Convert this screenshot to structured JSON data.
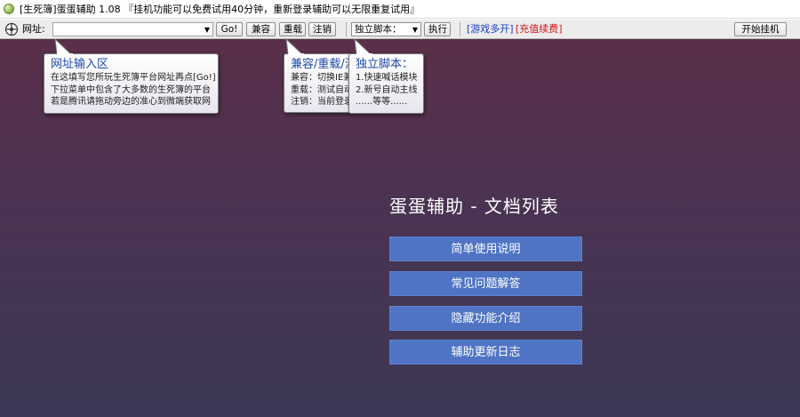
{
  "window": {
    "title": "[生死簿]蛋蛋辅助 1.08 『挂机功能可以免费试用40分钟，重新登录辅助可以无限重复试用』"
  },
  "toolbar": {
    "url_label": "网址:",
    "url_value": "",
    "go_button": "Go!",
    "compat_button": "兼容",
    "reload_button": "重载",
    "logout_button": "注销",
    "script_select": "独立脚本：",
    "run_button": "执行",
    "multi_link": "[游戏多开]",
    "recharge_link": "[充值续费]",
    "start_button": "开始挂机"
  },
  "tooltips": {
    "url_tip": {
      "title": "网址输入区",
      "lines": [
        "在这填写您所玩生死簿平台网址再点[Go!]",
        "下拉菜单中包含了大多数的生死簿的平台",
        "若是腾讯请拖动旁边的准心到微端获取网"
      ]
    },
    "compat_tip": {
      "title": "兼容/重载/注",
      "lines": [
        "兼容：切换IE兼",
        "重载：测试自动",
        "注销：当前登录"
      ]
    },
    "script_tip": {
      "title": "独立脚本：",
      "lines": [
        "1.快速喊话模块",
        "2.新号自动主线",
        "......等等......"
      ]
    }
  },
  "docs": {
    "title": "蛋蛋辅助 - 文档列表",
    "buttons": [
      "简单使用说明",
      "常见问题解答",
      "隐藏功能介绍",
      "辅助更新日志"
    ]
  },
  "colors": {
    "tooltip_title": "#1e4aa8",
    "doc_button": "#4f74c4",
    "link_blue": "#1a3ccc",
    "link_red": "#d01818"
  },
  "icons": {
    "app": "app-egg-icon",
    "crosshair": "crosshair-icon",
    "dropdown": "chevron-down-icon"
  }
}
